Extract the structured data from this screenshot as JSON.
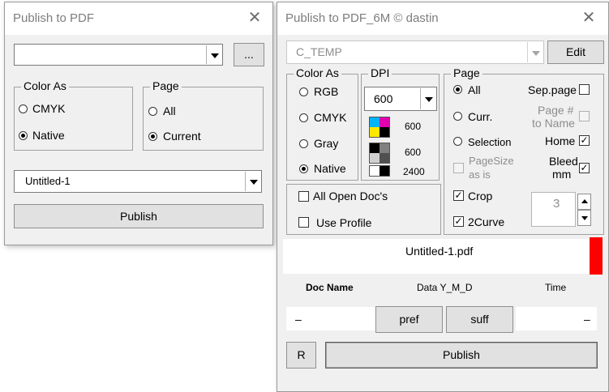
{
  "left_window": {
    "title": "Publish to PDF",
    "path_value": "",
    "browse_label": "...",
    "color_as": {
      "legend": "Color As",
      "options": [
        "CMYK",
        "Native"
      ],
      "selected": "Native"
    },
    "page": {
      "legend": "Page",
      "options": [
        "All",
        "Current"
      ],
      "selected": "Current"
    },
    "document_value": "Untitled-1",
    "publish_label": "Publish"
  },
  "right_window": {
    "title": "Publish to PDF_6M © dastin",
    "folder_value": "C_TEMP",
    "edit_label": "Edit",
    "color_as": {
      "legend": "Color As",
      "options": [
        "RGB",
        "CMYK",
        "Gray",
        "Native"
      ],
      "selected": "Native"
    },
    "dpi": {
      "legend": "DPI",
      "value": "600",
      "color_dpi": "600",
      "gray_dpi": "600",
      "mono_dpi": "2400"
    },
    "all_open_docs_label": "All Open Doc's",
    "all_open_docs_checked": false,
    "use_profile_label": "Use Profile",
    "use_profile_checked": false,
    "page": {
      "legend": "Page",
      "opt_all": "All",
      "opt_curr": "Curr.",
      "opt_selection": "Selection",
      "selected": "All",
      "sep_page_label": "Sep.page",
      "sep_page_checked": false,
      "page_to_name_label_1": "Page #",
      "page_to_name_label_2": "to Name",
      "page_to_name_checked": false,
      "home_label": "Home",
      "home_checked": true,
      "pagesize_label_1": "PageSize",
      "pagesize_label_2": "as is",
      "pagesize_checked": false,
      "bleed_label_1": "Bleed",
      "bleed_label_2": "mm",
      "bleed_checked": true,
      "crop_label": "Crop",
      "crop_checked": true,
      "curve_label": "2Curve",
      "curve_checked": true,
      "bleed_value": "3"
    },
    "filename": "Untitled-1.pdf",
    "status_color": "#ff0000",
    "col_doc_name": "Doc Name",
    "col_data": "Data Y_M_D",
    "col_time": "Time",
    "prefix_value": "–",
    "pref_label": "pref",
    "suff_label": "suff",
    "suffix_value": "–",
    "r_label": "R",
    "publish_label": "Publish"
  }
}
